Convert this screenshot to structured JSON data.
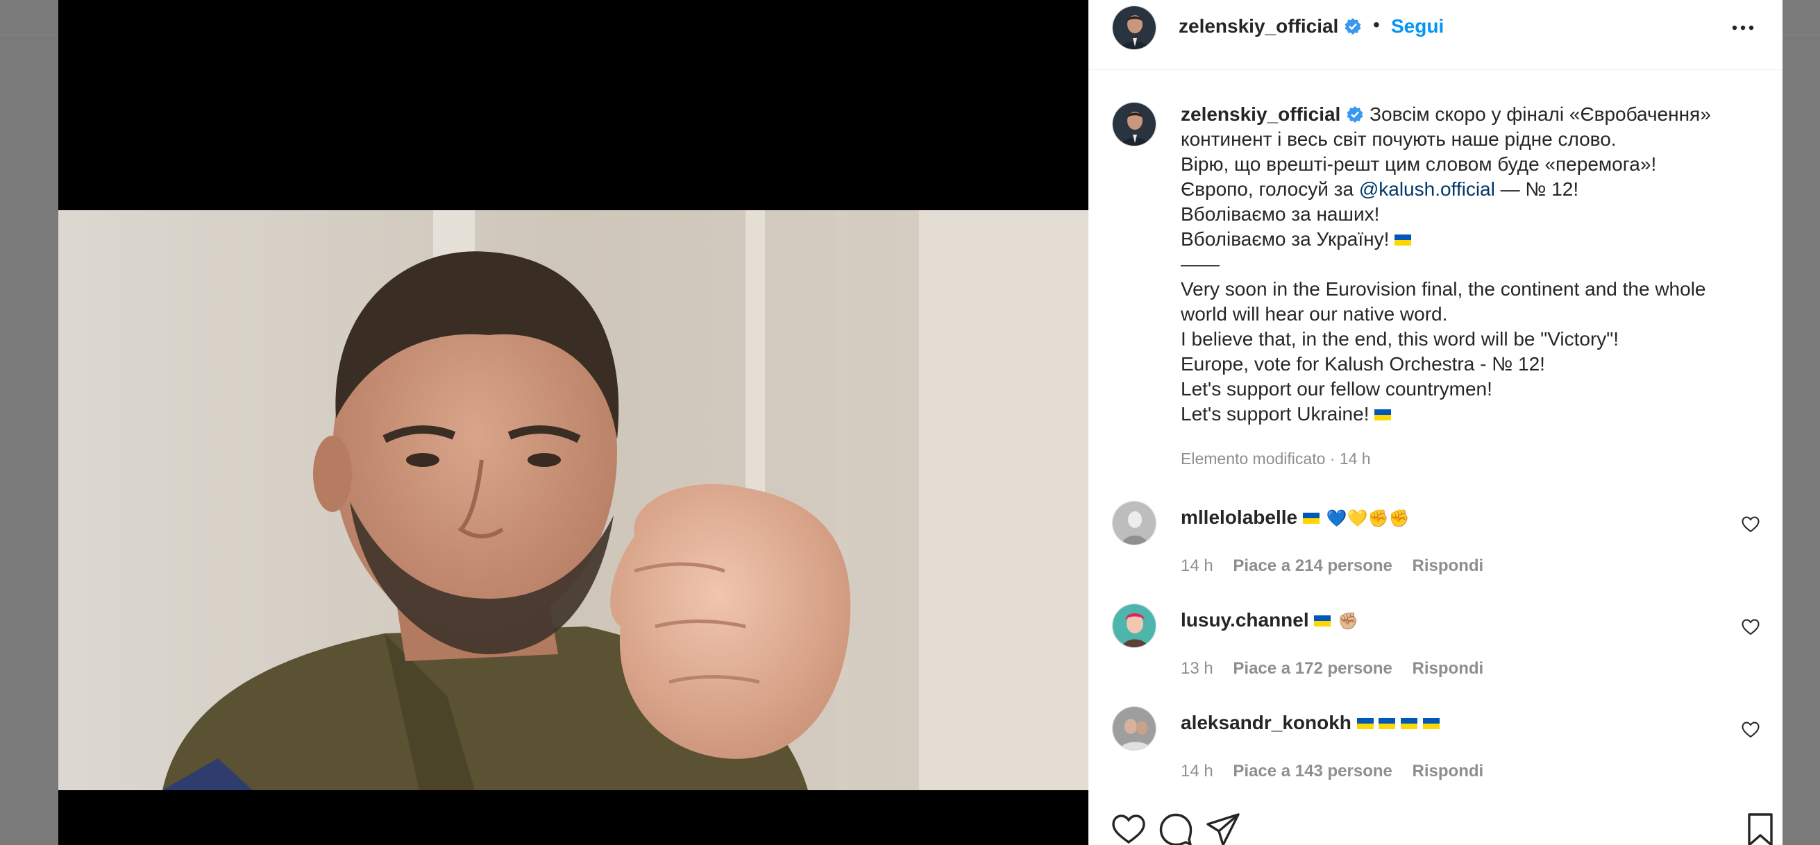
{
  "post": {
    "author": "zelenskiy_official",
    "follow_label": "Segui",
    "separator": "•",
    "caption": [
      "Зовсім скоро у фіналі «Євробачення»",
      "континент і весь світ почують наше рідне слово.",
      "Вірю, що врешті-решт цим словом буде «перемога»!",
      "Європо, голосуй за ",
      "@kalush.official",
      " — № 12!",
      "Вболіваємо за наших!",
      "Вболіваємо за Україну! ",
      "——",
      "Very soon in the Eurovision final, the continent and the whole",
      "world will hear our native word.",
      "I believe that, in the end, this word will be \"Victory\"!",
      "Europe, vote for Kalush Orchestra - № 12!",
      "Let's support our fellow countrymen!",
      "Let's support Ukraine! "
    ],
    "edited_label": "Elemento modificato · 14 h"
  },
  "comments": [
    {
      "user": "mllelolabelle",
      "emojis": "💙💛✊✊",
      "time": "14 h",
      "likes": "Piace a 214 persone",
      "reply": "Rispondi",
      "flags": 1
    },
    {
      "user": "lusuy.channel",
      "emojis": "✊🏼",
      "time": "13 h",
      "likes": "Piace a 172 persone",
      "reply": "Rispondi",
      "flags": 1
    },
    {
      "user": "aleksandr_konokh",
      "emojis": "",
      "time": "14 h",
      "likes": "Piace a 143 persone",
      "reply": "Rispondi",
      "flags": 4
    }
  ],
  "colors": {
    "accent": "#0095f6",
    "mention": "#00376b",
    "muted": "#8e8e8e",
    "flag_blue": "#0057b7",
    "flag_yellow": "#ffd700"
  },
  "icons": {
    "actions": [
      "heart-icon",
      "comment-icon",
      "share-icon",
      "bookmark-icon"
    ],
    "header": [
      "more-options-icon",
      "verified-badge-icon"
    ]
  }
}
